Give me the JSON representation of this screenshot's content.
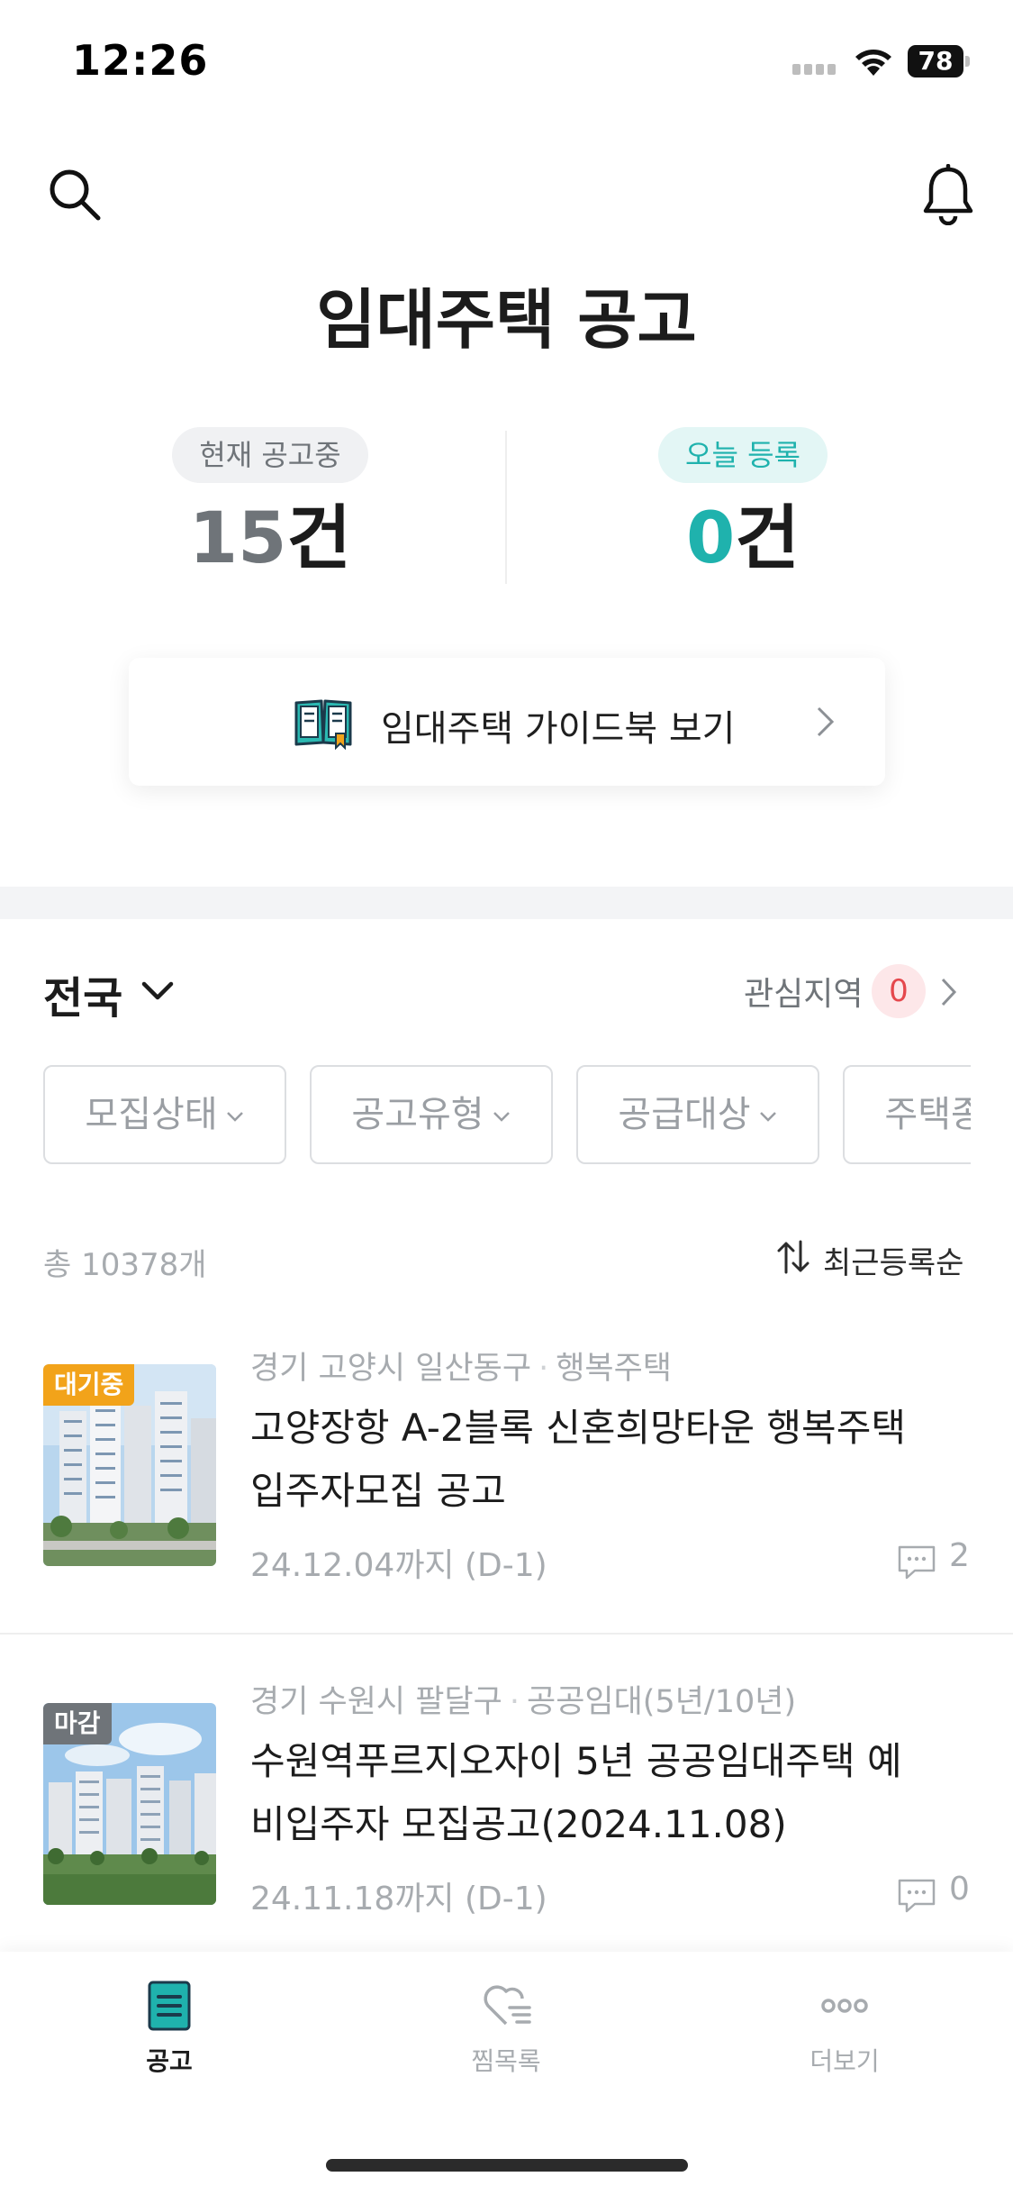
{
  "status_bar": {
    "time": "12:26",
    "battery": "78"
  },
  "header": {
    "title": "임대주택 공고"
  },
  "stats": {
    "current": {
      "label": "현재 공고중",
      "value": "15",
      "unit": "건"
    },
    "today": {
      "label": "오늘 등록",
      "value": "0",
      "unit": "건"
    }
  },
  "guidebook": {
    "label": "임대주택 가이드북 보기"
  },
  "region": {
    "selected": "전국",
    "interest_label": "관심지역",
    "interest_count": "0"
  },
  "filters": [
    "모집상태",
    "공고유형",
    "공급대상",
    "주택종류"
  ],
  "list_header": {
    "total": "총 10378개",
    "sort": "최근등록순"
  },
  "listings": [
    {
      "badge": "대기중",
      "region": "경기 고양시 일산동구",
      "type": "행복주택",
      "title_line1": "고양장항 A-2블록 신혼희망타운 행복주택",
      "title_line2": "입주자모집 공고",
      "deadline": "24.12.04까지 (D-1)",
      "comments": "2"
    },
    {
      "badge": "마감",
      "region": "경기 수원시 팔달구",
      "type": "공공임대(5년/10년)",
      "title_line1": "수원역푸르지오자이 5년 공공임대주택 예",
      "title_line2": "비입주자 모집공고(2024.11.08)",
      "deadline": "24.11.18까지 (D-1)",
      "comments": "0"
    }
  ],
  "bottom_nav": [
    {
      "label": "공고",
      "icon": "notice-icon",
      "active": true
    },
    {
      "label": "찜목록",
      "icon": "heart-list-icon",
      "active": false
    },
    {
      "label": "더보기",
      "icon": "more-icon",
      "active": false
    }
  ],
  "colors": {
    "accent": "#1fb2ad",
    "badge_wait": "#f2a31a",
    "badge_closed": "#6f7479",
    "interest_badge": "#e5484d"
  }
}
